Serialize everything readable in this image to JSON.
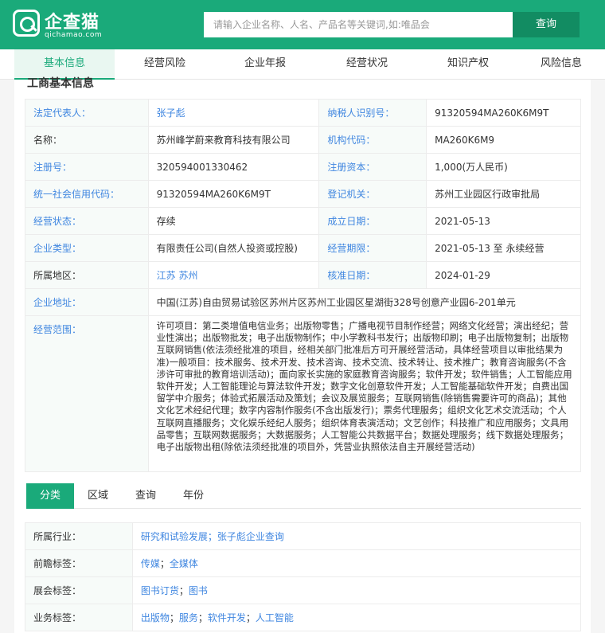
{
  "header": {
    "logo_name": "企查猫",
    "logo_domain": "qichamao.com",
    "search_placeholder": "请输入企业名称、人名、产品名等关键词,如:唯品会",
    "search_button": "查询"
  },
  "nav": {
    "tabs": [
      "基本信息",
      "经营风险",
      "企业年报",
      "经营状况",
      "知识产权",
      "风险信息"
    ],
    "active": "基本信息"
  },
  "section_title": "工商基本信息",
  "info": {
    "legal_rep_label": "法定代表人：",
    "legal_rep_value": "张子彪",
    "tax_id_label": "纳税人识别号：",
    "tax_id_value": "91320594MA260K6M9T",
    "name_label": "名称：",
    "name_value": "苏州峰学蔚来教育科技有限公司",
    "org_code_label": "机构代码：",
    "org_code_value": "MA260K6M9",
    "reg_no_label": "注册号：",
    "reg_no_value": "320594001330462",
    "capital_label": "注册资本：",
    "capital_value": "1,000(万人民币)",
    "credit_code_label": "统一社会信用代码：",
    "credit_code_value": "91320594MA260K6M9T",
    "authority_label": "登记机关：",
    "authority_value": "苏州工业园区行政审批局",
    "status_label": "经营状态：",
    "status_value": "存续",
    "founded_label": "成立日期：",
    "founded_value": "2021-05-13",
    "type_label": "企业类型：",
    "type_value": "有限责任公司(自然人投资或控股)",
    "term_label": "经营期限：",
    "term_value": "2021-05-13 至 永续经营",
    "region_label": "所属地区：",
    "region_value": "江苏 苏州",
    "approve_label": "核准日期：",
    "approve_value": "2024-01-29",
    "address_label": "企业地址：",
    "address_value": "中国(江苏)自由贸易试验区苏州片区苏州工业园区星湖街328号创意产业园6-201单元",
    "scope_label": "经营范围：",
    "scope_value": "许可项目：第二类增值电信业务；出版物零售；广播电视节目制作经营；网络文化经营；演出经纪；营业性演出；出版物批发；电子出版物制作；中小学教科书发行；出版物印刷；电子出版物复制；出版物互联网销售(依法须经批准的项目，经相关部门批准后方可开展经营活动，具体经营项目以审批结果为准)一般项目：技术服务、技术开发、技术咨询、技术交流、技术转让、技术推广；教育咨询服务(不含涉许可审批的教育培训活动)；面向家长实施的家庭教育咨询服务；软件开发；软件销售；人工智能应用软件开发；人工智能理论与算法软件开发；数字文化创意软件开发；人工智能基础软件开发；自费出国留学中介服务；体验式拓展活动及策划；会议及展览服务；互联网销售(除销售需要许可的商品)；其他文化艺术经纪代理；数字内容制作服务(不含出版发行)；票务代理服务；组织文化艺术交流活动；个人互联网直播服务；文化娱乐经纪人服务；组织体育表演活动；文艺创作；科技推广和应用服务；文具用品零售；互联网数据服务；大数据服务；人工智能公共数据平台；数据处理服务；线下数据处理服务；电子出版物出租(除依法须经批准的项目外，凭营业执照依法自主开展经营活动)"
  },
  "category_tabs": {
    "items": [
      "分类",
      "区域",
      "查询",
      "年份"
    ],
    "active": "分类"
  },
  "tags": {
    "industry_label": "所属行业：",
    "industry_1": "研究和试验发展",
    "industry_2": "张子彪企业查询",
    "prospect_label": "前瞻标签：",
    "prospect_1": "传媒",
    "prospect_2": "全媒体",
    "expo_label": "展会标签：",
    "expo_1": "图书订货",
    "expo_2": "图书",
    "business_label": "业务标签：",
    "business_1": "出版物",
    "business_2": "服务",
    "business_3": "软件开发",
    "business_4": "人工智能"
  },
  "colors": {
    "brand": "#1aaa7a",
    "brand_dark": "#128c62",
    "link": "#3f86e0",
    "label_bg": "#f7fbf9"
  }
}
